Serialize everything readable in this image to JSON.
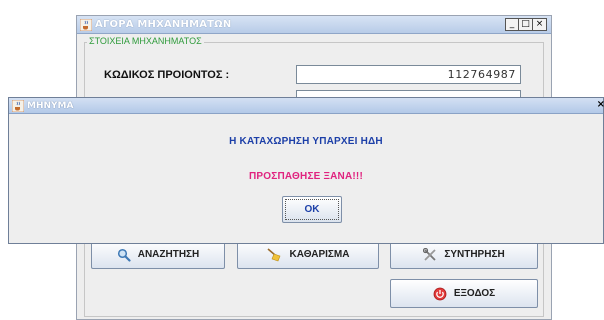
{
  "bg_window": {
    "title": "ΑΓΟΡΑ ΜΗΧΑΝΗΜΑΤΩΝ",
    "controls": {
      "minimize": "_",
      "maximize": "□",
      "close": "×"
    },
    "group_label": "ΣΤΟΙΧΕΙΑ ΜΗΧΑΝΗΜΑΤΟΣ",
    "product_code_label": "ΚΩΔΙΚΟΣ ΠΡΟΙΟΝΤΟΣ :",
    "product_code_value": "112764987",
    "buttons": {
      "search": {
        "label": "ΑΝΑΖΗΤΗΣΗ",
        "icon": "magnifier-icon"
      },
      "clear": {
        "label": "ΚΑΘΑΡΙΣΜΑ",
        "icon": "broom-icon"
      },
      "maintenance": {
        "label": "ΣΥΝΤΗΡΗΣΗ",
        "icon": "tools-icon"
      },
      "exit": {
        "label": "ΕΞΟΔΟΣ",
        "icon": "power-icon"
      }
    }
  },
  "dialog": {
    "title": "ΜΗΝΥΜΑ",
    "close": "×",
    "message_primary": "Η ΚΑΤΑΧΩΡΗΣΗ ΥΠΑΡΧΕΙ ΗΔΗ",
    "message_secondary": "ΠΡΟΣΠΑΘΗΣΕ ΞΑΝΑ!!!",
    "ok_label": "OK"
  },
  "colors": {
    "message_primary": "#1c3fa8",
    "message_secondary": "#e0237f",
    "group_label": "#2f9b3c"
  }
}
